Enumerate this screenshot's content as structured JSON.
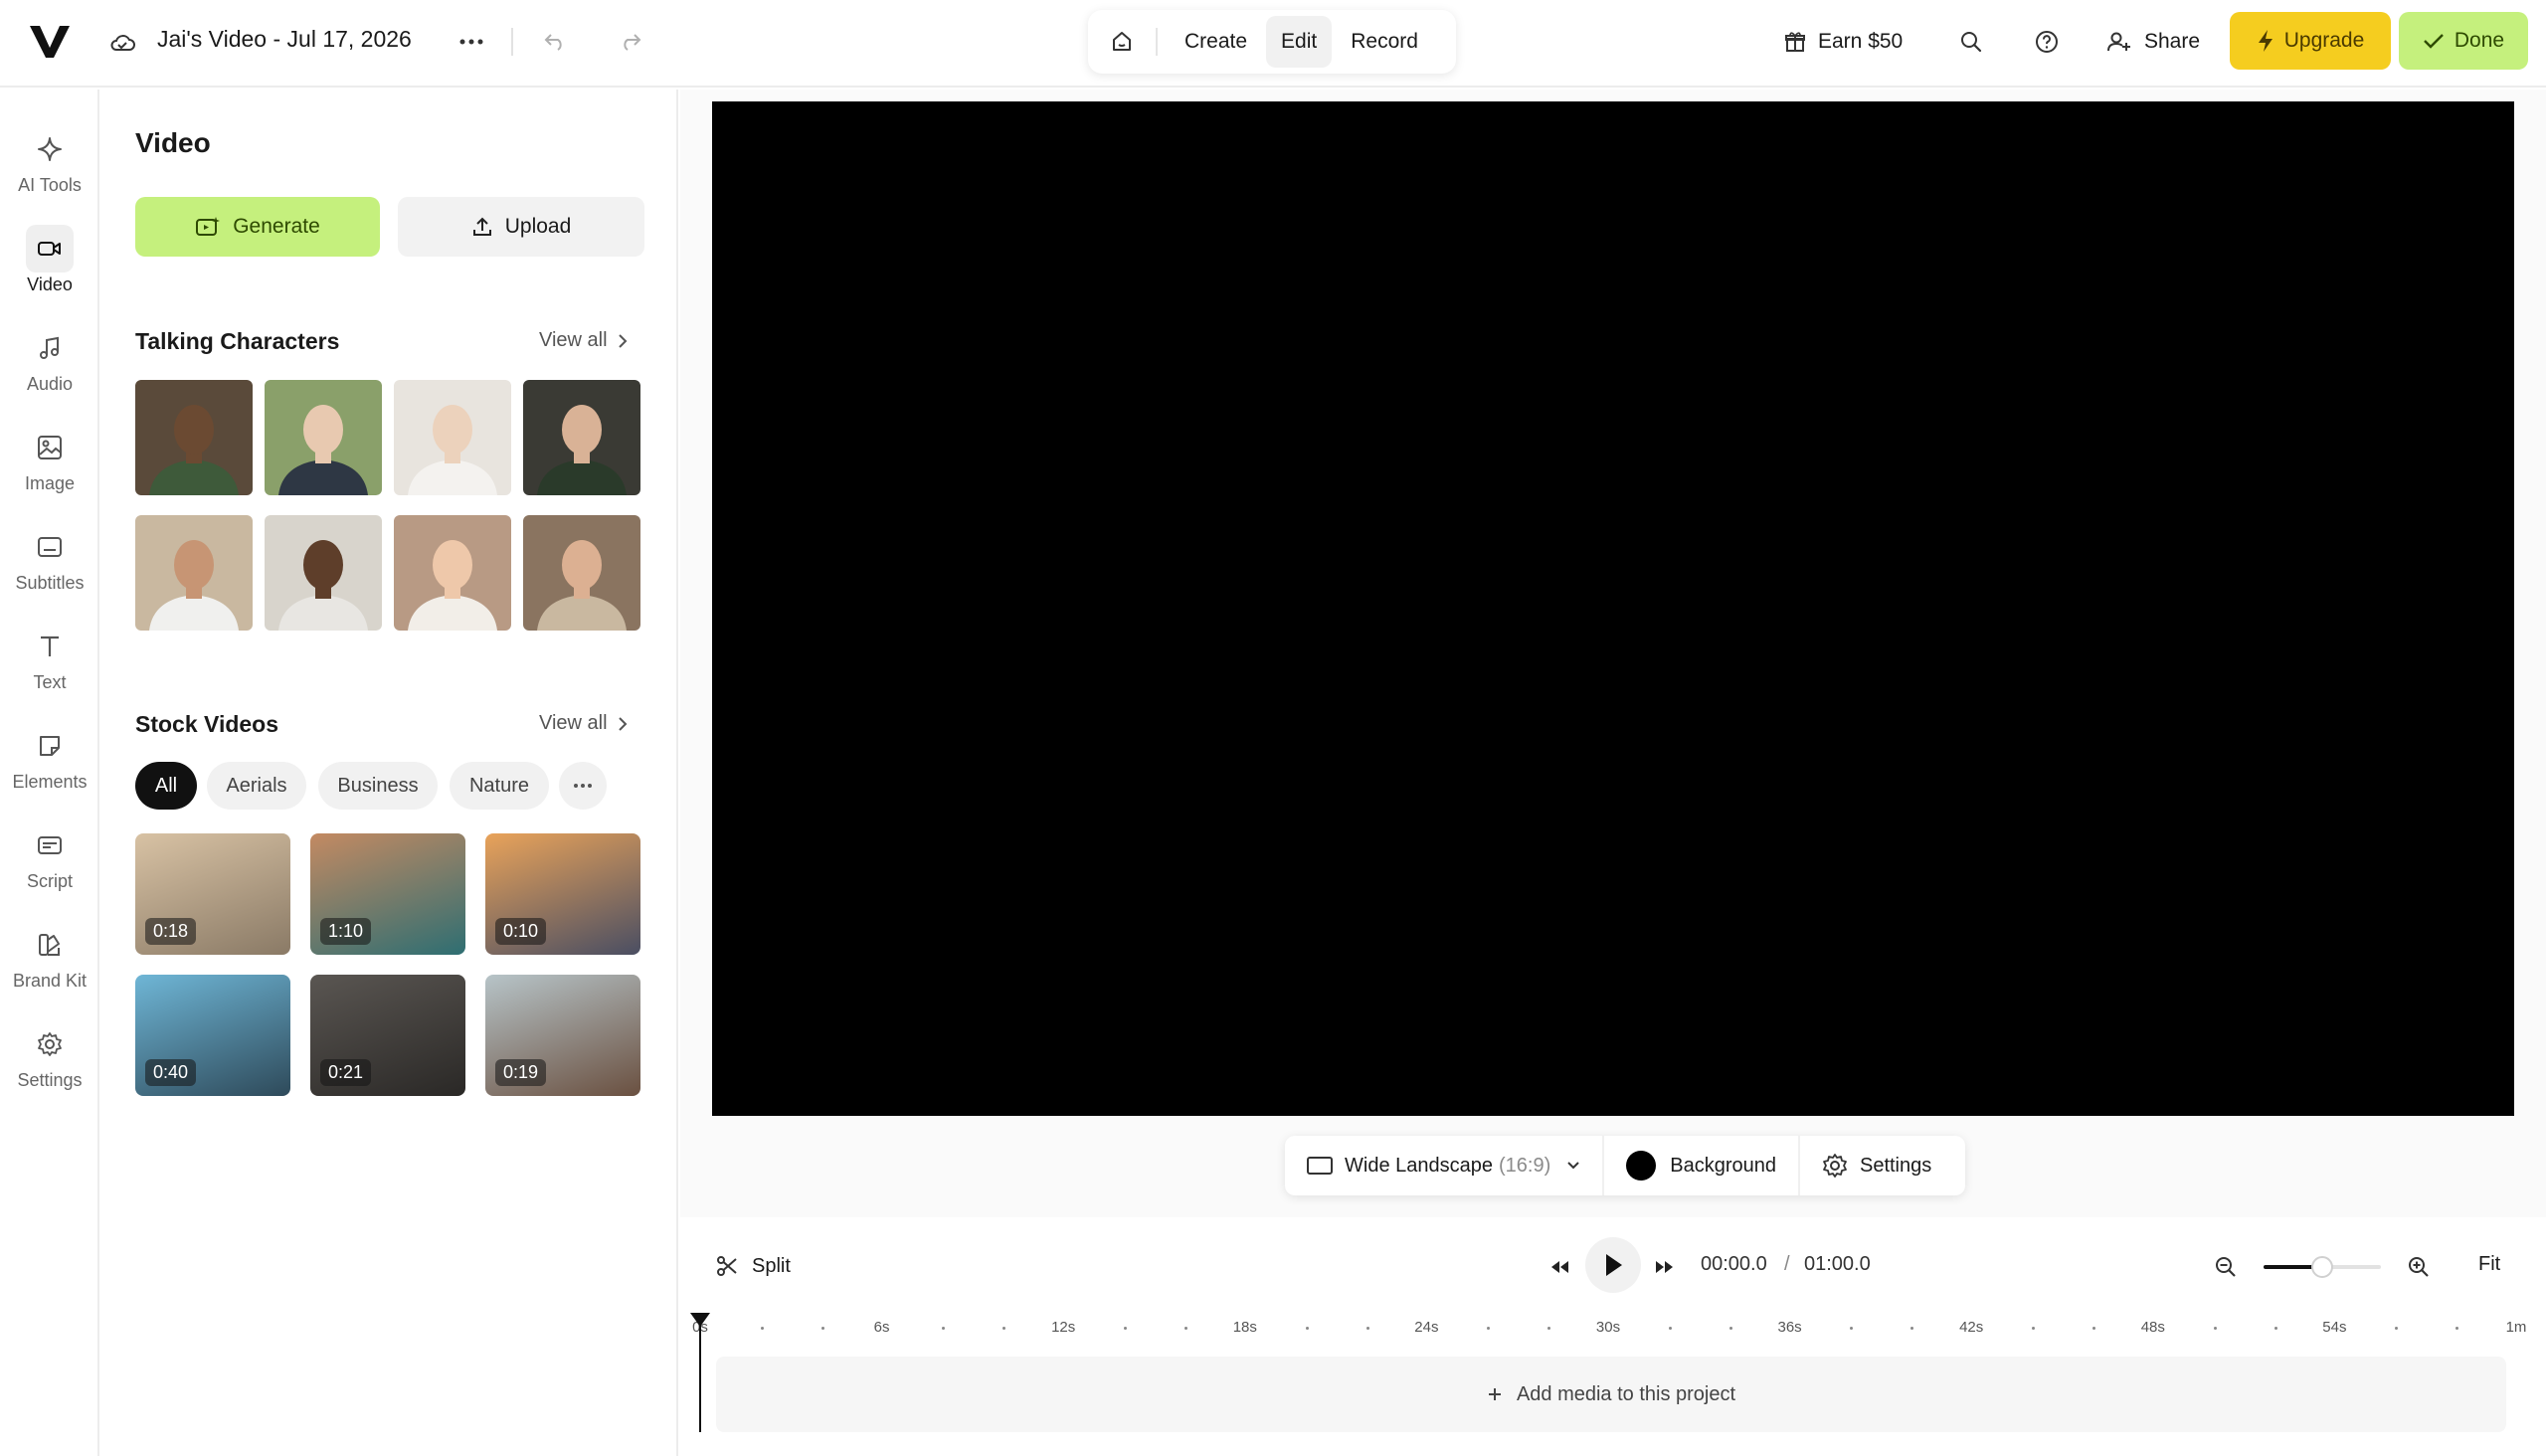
{
  "header": {
    "logo": "V",
    "project_title": "Jai's Video - Jul 17, 2026",
    "modes": [
      {
        "label": "Create",
        "active": false
      },
      {
        "label": "Edit",
        "active": true
      },
      {
        "label": "Record",
        "active": false
      }
    ],
    "earn_label": "Earn $50",
    "share_label": "Share",
    "upgrade_label": "Upgrade",
    "done_label": "Done",
    "accent_yellow": "#f5cd1f",
    "accent_green": "#c5f07d"
  },
  "rail": {
    "items": [
      {
        "label": "AI Tools",
        "icon": "sparkle-icon",
        "active": false
      },
      {
        "label": "Video",
        "icon": "video-camera-icon",
        "active": true
      },
      {
        "label": "Audio",
        "icon": "music-note-icon",
        "active": false
      },
      {
        "label": "Image",
        "icon": "image-icon",
        "active": false
      },
      {
        "label": "Subtitles",
        "icon": "subtitles-icon",
        "active": false
      },
      {
        "label": "Text",
        "icon": "text-icon",
        "active": false
      },
      {
        "label": "Elements",
        "icon": "sticker-icon",
        "active": false
      },
      {
        "label": "Script",
        "icon": "script-icon",
        "active": false
      },
      {
        "label": "Brand Kit",
        "icon": "brand-kit-icon",
        "active": false
      },
      {
        "label": "Settings",
        "icon": "gear-icon",
        "active": false
      }
    ]
  },
  "panel": {
    "title": "Video",
    "generate_label": "Generate",
    "upload_label": "Upload",
    "talking": {
      "title": "Talking Characters",
      "view_all": "View all",
      "characters": [
        {
          "bg": "#5a4a3a",
          "skin": "#6b4a32",
          "shirt": "#3e5a3a"
        },
        {
          "bg": "#8aa06a",
          "skin": "#e8c9b0",
          "shirt": "#2e3744"
        },
        {
          "bg": "#e8e4de",
          "skin": "#ecd2bc",
          "shirt": "#f4f2ef"
        },
        {
          "bg": "#3a3a34",
          "skin": "#d9b296",
          "shirt": "#2a3a2a"
        },
        {
          "bg": "#c9b8a0",
          "skin": "#c79574",
          "shirt": "#f0f0ee"
        },
        {
          "bg": "#d8d4cc",
          "skin": "#5e3e2a",
          "shirt": "#e8e6e2"
        },
        {
          "bg": "#b89a84",
          "skin": "#eec8aa",
          "shirt": "#f2eee8"
        },
        {
          "bg": "#8a7460",
          "skin": "#dcb092",
          "shirt": "#c9b8a0"
        }
      ]
    },
    "stock": {
      "title": "Stock Videos",
      "view_all": "View all",
      "chips": [
        {
          "label": "All",
          "active": true
        },
        {
          "label": "Aerials",
          "active": false
        },
        {
          "label": "Business",
          "active": false
        },
        {
          "label": "Nature",
          "active": false
        }
      ],
      "videos": [
        {
          "duration": "0:18",
          "c1": "#d8c2a4",
          "c2": "#8a7a66"
        },
        {
          "duration": "1:10",
          "c1": "#c48a62",
          "c2": "#2e6e72"
        },
        {
          "duration": "0:10",
          "c1": "#e9a35a",
          "c2": "#4a4e62"
        },
        {
          "duration": "0:40",
          "c1": "#6fb6d6",
          "c2": "#2e4a5a"
        },
        {
          "duration": "0:21",
          "c1": "#5a5652",
          "c2": "#2a2826"
        },
        {
          "duration": "0:19",
          "c1": "#b7c4c8",
          "c2": "#6a5040"
        }
      ]
    }
  },
  "canvas": {
    "aspect_label": "Wide Landscape",
    "aspect_ratio": "(16:9)",
    "background_label": "Background",
    "settings_label": "Settings",
    "background_color": "#000000"
  },
  "timeline": {
    "split_label": "Split",
    "current_time": "00:00.0",
    "separator": "/",
    "total_time": "01:00.0",
    "zoom_level": 0.5,
    "fit_label": "Fit",
    "ruler_labels": [
      "0s",
      "6s",
      "12s",
      "18s",
      "24s",
      "30s",
      "36s",
      "42s",
      "48s",
      "54s",
      "1m"
    ],
    "add_media_label": "Add media to this project"
  }
}
